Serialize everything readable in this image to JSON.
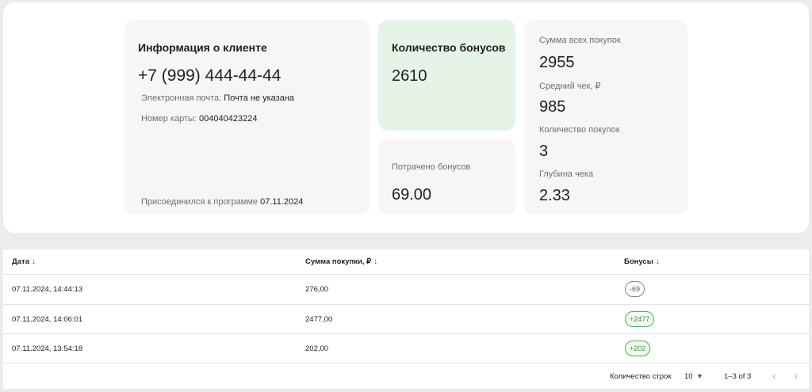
{
  "client_info": {
    "title": "Информация о клиенте",
    "phone": "+7 (999) 444-44-44",
    "email_label": "Электронная почта:",
    "email_value": "Почта не указана",
    "card_label": "Номер карты:",
    "card_value": "004040423224",
    "joined_label": "Присоединился к программе",
    "joined_value": "07.11.2024"
  },
  "bonus_card": {
    "title": "Количество бонусов",
    "value": "2610"
  },
  "spent_card": {
    "label": "Потрачено бонусов",
    "value": "69.00"
  },
  "stats_card": {
    "items": [
      {
        "label": "Сумма всех покупок",
        "value": "2955"
      },
      {
        "label": "Средний чек, ₽",
        "value": "985"
      },
      {
        "label": "Количество покупок",
        "value": "3"
      },
      {
        "label": "Глубина чека",
        "value": "2.33"
      }
    ]
  },
  "table": {
    "columns": [
      {
        "label": "Дата"
      },
      {
        "label": "Сумма покупки, ₽"
      },
      {
        "label": "Бонусы"
      }
    ],
    "sort_icon": "↓",
    "rows": [
      {
        "date": "07.11.2024, 14:44:13",
        "amount": "276,00",
        "bonus": "-69"
      },
      {
        "date": "07.11.2024, 14:06:01",
        "amount": "2477,00",
        "bonus": "+2477"
      },
      {
        "date": "07.11.2024, 13:54:18",
        "amount": "202,00",
        "bonus": "+202"
      }
    ],
    "footer": {
      "rows_label": "Количество строк",
      "rows_value": "10",
      "range": "1–3 of 3",
      "prev_icon": "‹",
      "next_icon": "›"
    }
  },
  "colors": {
    "bonus_card_bg": "#e6f4e8",
    "positive_chip": "#4caf50",
    "neutral_chip": "#888888"
  }
}
